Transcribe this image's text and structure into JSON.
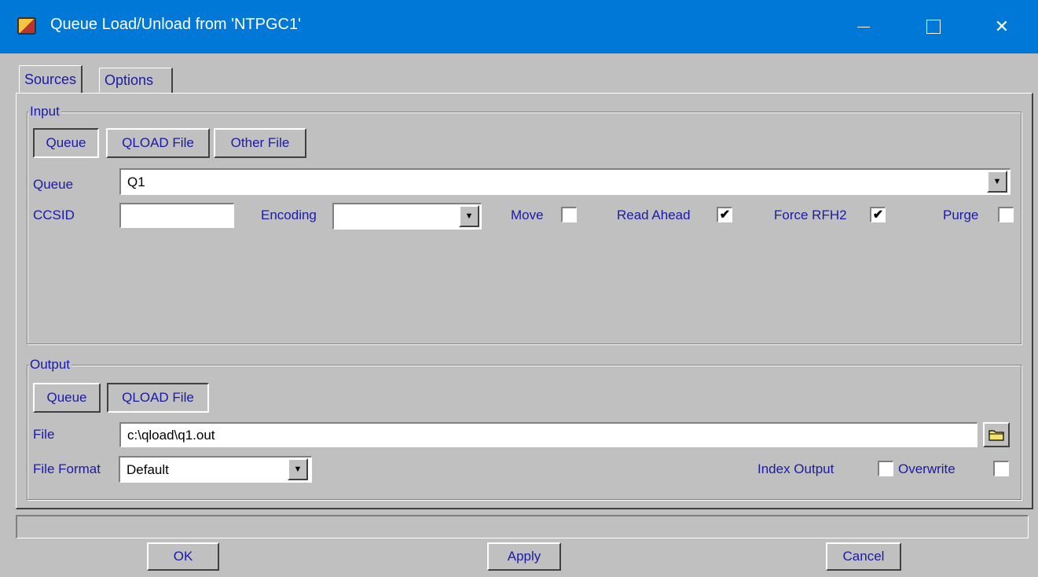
{
  "window": {
    "title": "Queue Load/Unload from 'NTPGC1'",
    "close_glyph": "✕",
    "icon": "app-icon"
  },
  "tabs": [
    {
      "label": "Sources",
      "selected": true
    },
    {
      "label": "Options",
      "selected": false
    }
  ],
  "input": {
    "legend": "Input",
    "source_buttons": [
      {
        "label": "Queue",
        "pressed": true
      },
      {
        "label": "QLOAD File",
        "pressed": false
      },
      {
        "label": "Other File",
        "pressed": false
      }
    ],
    "queue_label": "Queue",
    "queue_value": "Q1",
    "ccsid_label": "CCSID",
    "ccsid_value": "",
    "encoding_label": "Encoding",
    "encoding_value": "",
    "move_label": "Move",
    "move_checked": "",
    "read_ahead_label": "Read Ahead",
    "read_ahead_checked": "✔",
    "force_rfh2_label": "Force RFH2",
    "force_rfh2_checked": "✔",
    "purge_label": "Purge",
    "purge_checked": ""
  },
  "output": {
    "legend": "Output",
    "target_buttons": [
      {
        "label": "Queue",
        "pressed": false
      },
      {
        "label": "QLOAD File",
        "pressed": true
      }
    ],
    "file_label": "File",
    "file_value": "c:\\qload\\q1.out",
    "file_format_label": "File Format",
    "file_format_value": "Default",
    "index_output_label": "Index Output",
    "index_output_checked": "",
    "overwrite_label": "Overwrite",
    "overwrite_checked": ""
  },
  "footer": {
    "ok_label": "OK",
    "apply_label": "Apply",
    "cancel_label": "Cancel"
  },
  "colors": {
    "titlebar": "#0078d7",
    "label_text": "#1a1aa8",
    "dialog_bg": "#c0c0c0"
  }
}
